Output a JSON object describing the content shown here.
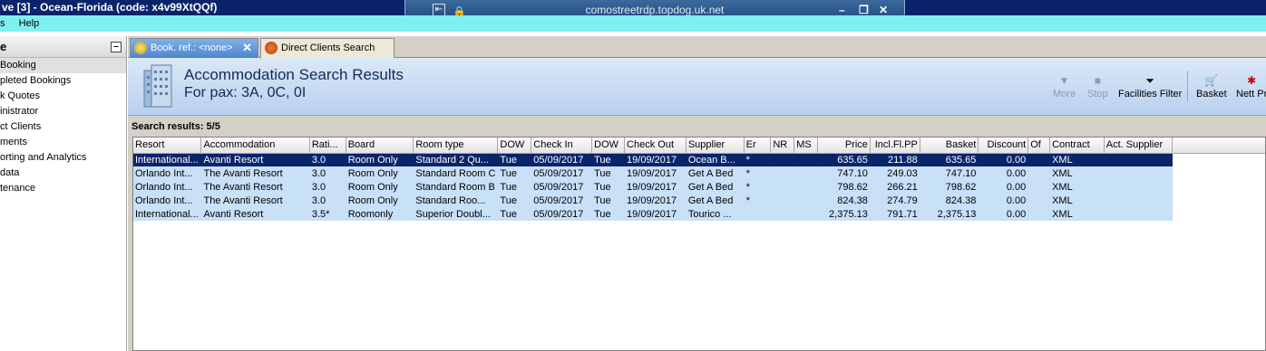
{
  "window": {
    "title": "ve [3] - Ocean-Florida (code: x4v99XtQQf)",
    "rdp_host": "comostreetrdp.topdog.uk.net",
    "rdp_controls": [
      "–",
      "❐",
      "✕"
    ]
  },
  "menu": [
    "s",
    "Help"
  ],
  "sidebar": {
    "header": "e",
    "collapse_glyph": "–",
    "items": [
      {
        "label": " Booking",
        "active": true
      },
      {
        "label": "pleted Bookings",
        "active": false
      },
      {
        "label": "k Quotes",
        "active": false
      },
      {
        "label": "inistrator",
        "active": false
      },
      {
        "label": "ct Clients",
        "active": false
      },
      {
        "label": "ments",
        "active": false
      },
      {
        "label": "orting and Analytics",
        "active": false
      },
      {
        "label": "data",
        "active": false
      },
      {
        "label": "tenance",
        "active": false
      }
    ]
  },
  "tabs": [
    {
      "label": "Book. ref.: <none>",
      "active": true,
      "close": "✕"
    },
    {
      "label": "Direct Clients Search",
      "active": false
    }
  ],
  "header": {
    "title": "Accommodation Search Results",
    "subtitle": "For pax: 3A, 0C, 0I"
  },
  "toolbar": [
    {
      "label": "More",
      "icon": "more-icon",
      "glyph": "▼",
      "enabled": false
    },
    {
      "label": "Stop",
      "icon": "stop-icon",
      "glyph": "■",
      "enabled": false
    },
    {
      "label": "Facilities Filter",
      "icon": "filter-icon",
      "glyph": "⏷",
      "enabled": true
    },
    {
      "label": "Basket",
      "icon": "basket-icon",
      "glyph": "🛒",
      "enabled": true
    },
    {
      "label": "Nett Pr",
      "icon": "nett-price-icon",
      "glyph": "✱",
      "enabled": true
    }
  ],
  "results": {
    "label": "Search results: 5/5",
    "columns": [
      "Resort",
      "Accommodation",
      "Rati...",
      "Board",
      "Room type",
      "DOW",
      "Check In",
      "DOW",
      "Check Out",
      "Supplier",
      "Er",
      "NR",
      "MS",
      "Price",
      "Incl.Fl.PP",
      "Basket",
      "Discount",
      "Of",
      "Contract",
      "Act. Supplier"
    ],
    "rows": [
      [
        "International...",
        "Avanti Resort",
        "3.0",
        "Room Only",
        "Standard 2 Qu...",
        "Tue",
        "05/09/2017",
        "Tue",
        "19/09/2017",
        "Ocean B...",
        "*",
        "",
        "",
        "635.65",
        "211.88",
        "635.65",
        "0.00",
        "",
        "XML",
        ""
      ],
      [
        "Orlando Int...",
        "The Avanti Resort",
        "3.0",
        "Room Only",
        "Standard Room C",
        "Tue",
        "05/09/2017",
        "Tue",
        "19/09/2017",
        "Get A Bed",
        "*",
        "",
        "",
        "747.10",
        "249.03",
        "747.10",
        "0.00",
        "",
        "XML",
        ""
      ],
      [
        "Orlando Int...",
        "The Avanti Resort",
        "3.0",
        "Room Only",
        "Standard Room B",
        "Tue",
        "05/09/2017",
        "Tue",
        "19/09/2017",
        "Get A Bed",
        "*",
        "",
        "",
        "798.62",
        "266.21",
        "798.62",
        "0.00",
        "",
        "XML",
        ""
      ],
      [
        "Orlando Int...",
        "The Avanti Resort",
        "3.0",
        "Room Only",
        "Standard Roo...",
        "Tue",
        "05/09/2017",
        "Tue",
        "19/09/2017",
        "Get A Bed",
        "*",
        "",
        "",
        "824.38",
        "274.79",
        "824.38",
        "0.00",
        "",
        "XML",
        ""
      ],
      [
        "International...",
        "Avanti Resort",
        "3.5*",
        "Roomonly",
        "Superior Doubl...",
        "Tue",
        "05/09/2017",
        "Tue",
        "19/09/2017",
        "Tourico ...",
        "",
        "",
        "",
        "2,375.13",
        "791.71",
        "2,375.13",
        "0.00",
        "",
        "XML",
        ""
      ]
    ],
    "selected_row": 0
  }
}
